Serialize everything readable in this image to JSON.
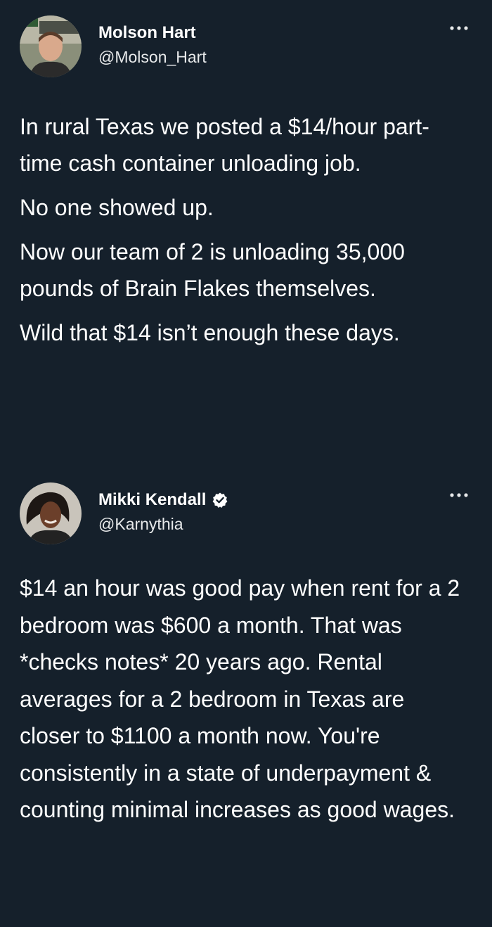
{
  "tweets": [
    {
      "display_name": "Molson Hart",
      "handle": "@Molson_Hart",
      "verified": false,
      "paragraphs": [
        "In rural Texas we posted a $14/hour part-time cash container unloading job.",
        "No one showed up.",
        "Now our team of 2 is unloading 35,000 pounds of Brain Flakes themselves.",
        "Wild that $14 isn’t enough these days."
      ]
    },
    {
      "display_name": "Mikki Kendall",
      "handle": "@Karnythia",
      "verified": true,
      "paragraphs": [
        "$14 an hour was good pay when rent for a 2 bedroom was $600 a month. That was *checks notes* 20 years ago. Rental averages for a 2 bedroom in Texas are closer to $1100 a month now.  You're consistently in a state of underpayment & counting minimal increases as good wages."
      ]
    }
  ],
  "colors": {
    "background": "#15202b",
    "text": "#ffffff",
    "verified_badge": "#ffffff"
  },
  "icons": {
    "more": "more-horizontal-icon",
    "verified": "verified-badge-icon"
  }
}
